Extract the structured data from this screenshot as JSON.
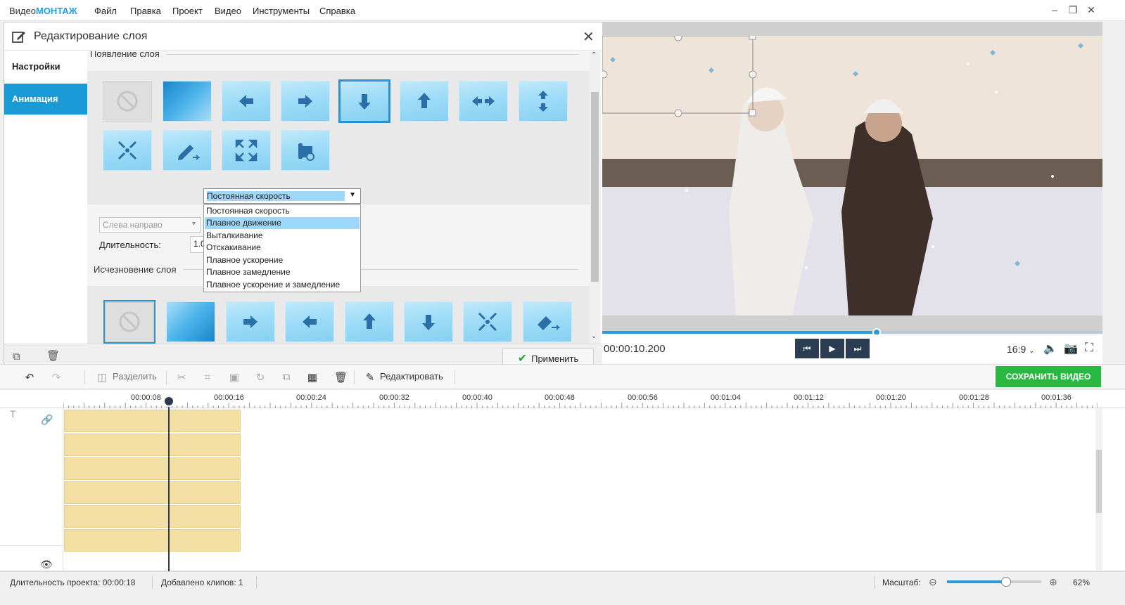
{
  "app": {
    "title_a": "Видео",
    "title_b": "МОНТАЖ"
  },
  "menu": [
    "Файл",
    "Правка",
    "Проект",
    "Видео",
    "Инструменты",
    "Справка"
  ],
  "dialog": {
    "title": "Редактирование слоя",
    "tabs": {
      "settings": "Настройки",
      "animation": "Анимация"
    },
    "appear_title": "Появление слоя",
    "disappear_title": "Исчезновение слоя",
    "direction_select": "Слева направо",
    "speed_select": "Постоянная скорость",
    "duration_label": "Длительность:",
    "duration_value": "1.00",
    "apply_label": "Применить",
    "speed_options": [
      "Постоянная скорость",
      "Плавное движение",
      "Выталкивание",
      "Отскакивание",
      "Плавное ускорение",
      "Плавное замедление",
      "Плавное ускорение и замедление"
    ],
    "highlighted_option_index": 1
  },
  "player": {
    "time": "00:00:10.200",
    "ratio": "16:9",
    "progress": 0.547
  },
  "toolbar": {
    "split_label": "Разделить",
    "edit_label": "Редактировать",
    "save_label": "СОХРАНИТЬ ВИДЕО"
  },
  "timeline": {
    "ticks": [
      "00:00:08",
      "00:00:16",
      "00:00:24",
      "00:00:32",
      "00:00:40",
      "00:00:48",
      "00:00:56",
      "00:01:04",
      "00:01:12",
      "00:01:20",
      "00:01:28",
      "00:01:36"
    ]
  },
  "status": {
    "duration": "Длительность проекта:  00:00:18",
    "clips": "Добавлено клипов: 1",
    "zoom_label": "Масштаб:",
    "zoom_value": "62%",
    "zoom_level": 0.62
  },
  "colors": {
    "accent": "#1a9ad6",
    "save": "#2ab840",
    "clip": "#f3dfa4"
  }
}
